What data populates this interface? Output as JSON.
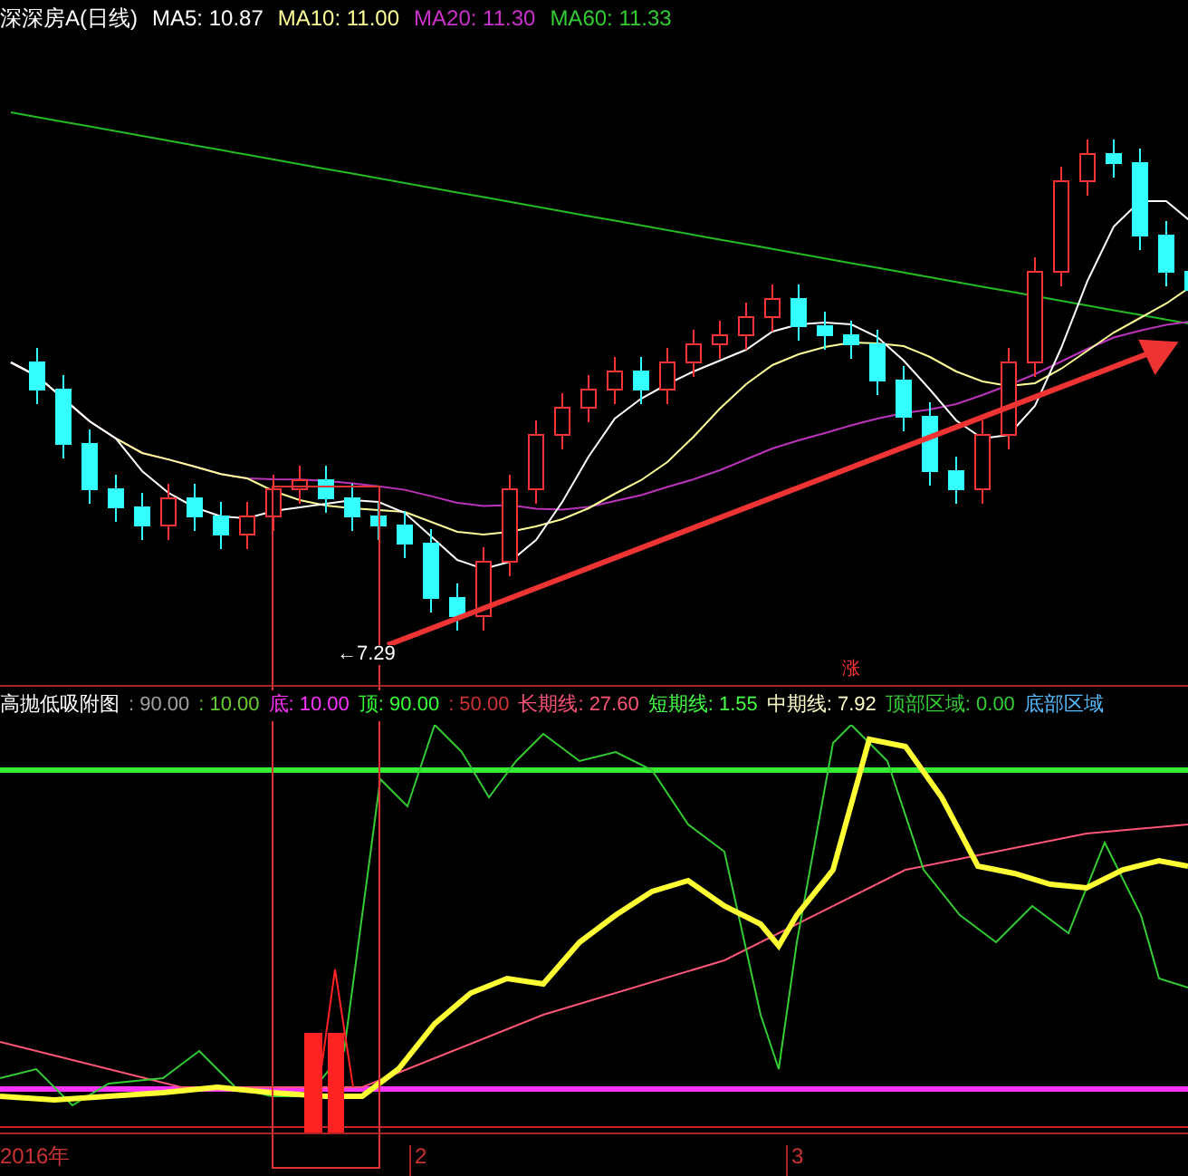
{
  "header": {
    "title": "深深房A(日线)",
    "items": [
      {
        "label": "MA5: 10.87",
        "color": "#ffffff"
      },
      {
        "label": "MA10: 11.00",
        "color": "#ffff99"
      },
      {
        "label": "MA20: 11.30",
        "color": "#cc33cc"
      },
      {
        "label": "MA60: 11.33",
        "color": "#33cc33"
      }
    ]
  },
  "main_chart": {
    "low_label": "←7.29",
    "marker": "涨"
  },
  "indicator": {
    "items": [
      {
        "label": "高抛低吸附图",
        "color": "#ffffff"
      },
      {
        "label": ": 90.00",
        "color": "#a0a0a0"
      },
      {
        "label": ": 10.00",
        "color": "#66cc33"
      },
      {
        "label": "底: 10.00",
        "color": "#ff33ff"
      },
      {
        "label": "顶: 90.00",
        "color": "#33ff33"
      },
      {
        "label": ": 50.00",
        "color": "#cc3333"
      },
      {
        "label": "长期线: 27.60",
        "color": "#ff5577"
      },
      {
        "label": "短期线: 1.55",
        "color": "#44ff44"
      },
      {
        "label": "中期线: 7.92",
        "color": "#ffffcc"
      },
      {
        "label": "顶部区域: 0.00",
        "color": "#33cc33"
      },
      {
        "label": "底部区域",
        "color": "#55bbff"
      }
    ]
  },
  "x_axis": {
    "labels": [
      "2016年",
      "2",
      "3"
    ]
  }
}
